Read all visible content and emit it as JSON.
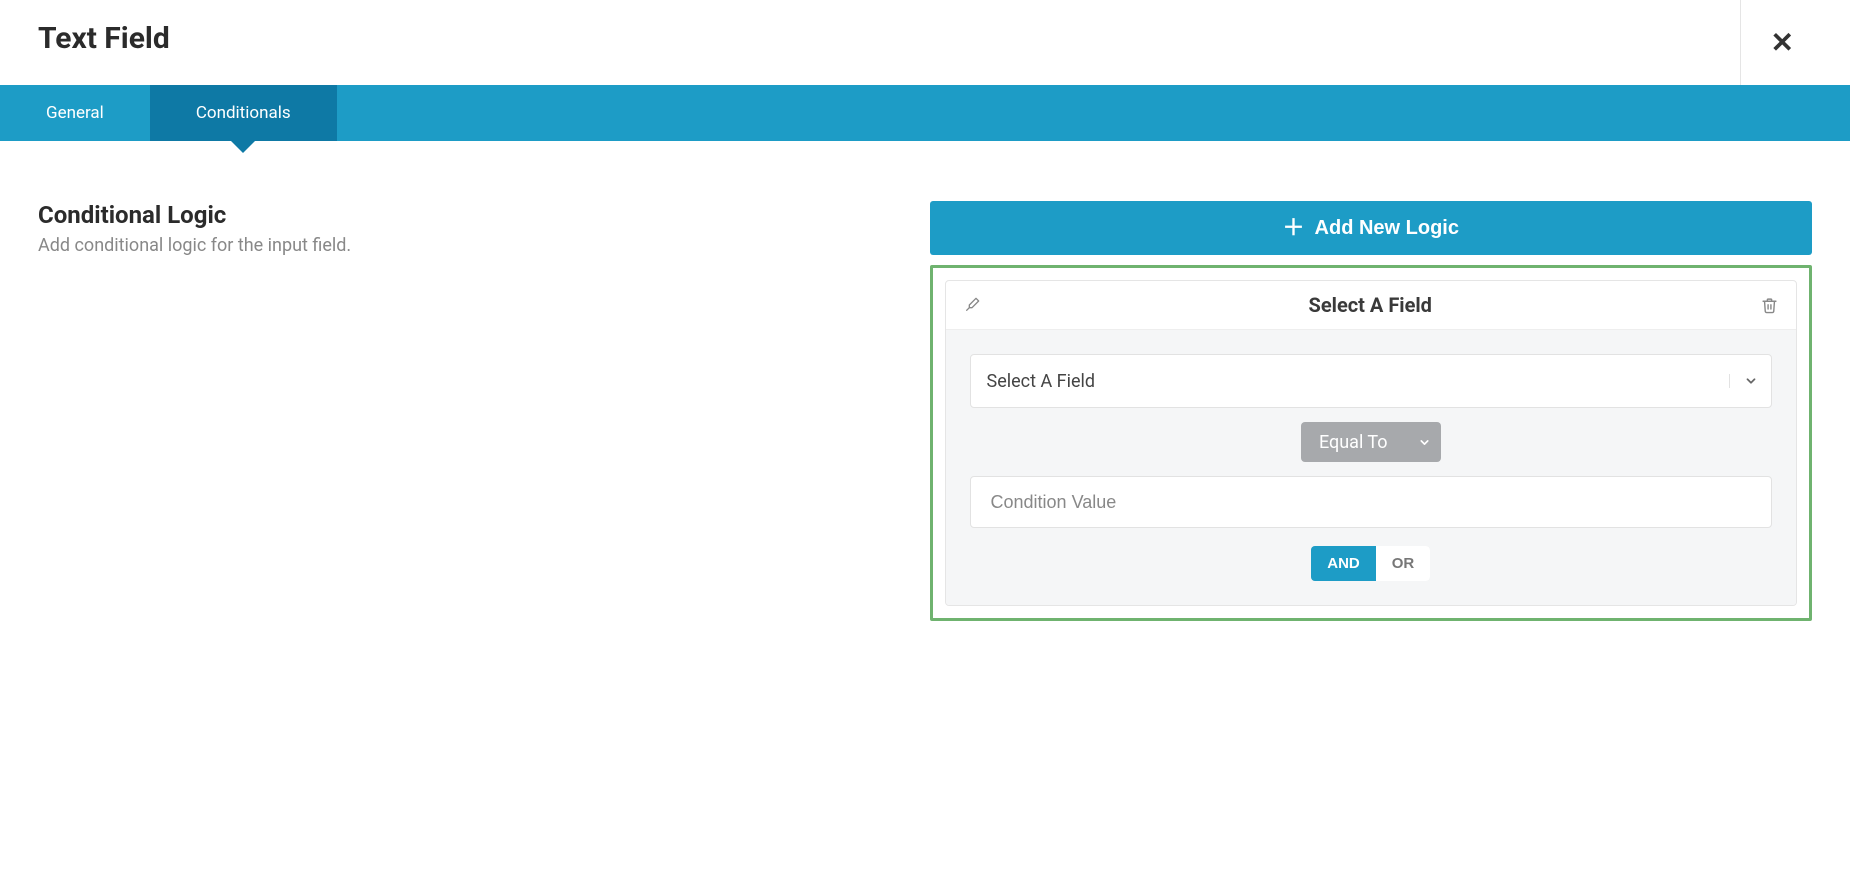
{
  "header": {
    "title": "Text Field"
  },
  "tabs": {
    "general": "General",
    "conditionals": "Conditionals"
  },
  "section": {
    "heading": "Conditional Logic",
    "sub": "Add conditional logic for the input field."
  },
  "actions": {
    "add_label": "Add New Logic"
  },
  "card": {
    "title": "Select A Field",
    "field_placeholder": "Select A Field",
    "operator": "Equal To",
    "value_placeholder": "Condition Value",
    "and_label": "AND",
    "or_label": "OR"
  }
}
